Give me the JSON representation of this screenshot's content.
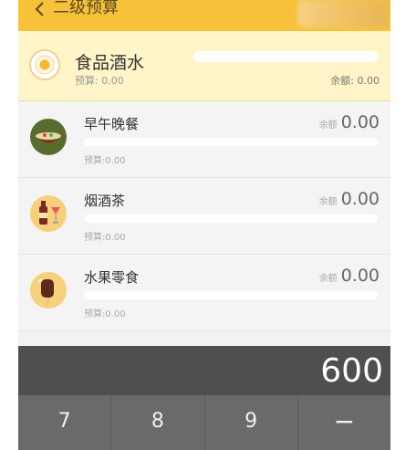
{
  "header": {
    "title": "二级预算",
    "back_icon": "chevron-left-icon"
  },
  "category": {
    "title": "食品酒水",
    "budget": "预算: 0.00",
    "remain": "余额: 0.00",
    "icon": "plate-egg-icon"
  },
  "rows": [
    {
      "name": "早午晚餐",
      "remain_label": "余额",
      "remain_value": "0.00",
      "budget": "预算:0.00",
      "icon": "bowl-icon"
    },
    {
      "name": "烟酒茶",
      "remain_label": "余额",
      "remain_value": "0.00",
      "budget": "预算:0.00",
      "icon": "bottle-glass-icon"
    },
    {
      "name": "水果零食",
      "remain_label": "余额",
      "remain_value": "0.00",
      "budget": "预算:0.00",
      "icon": "popsicle-icon"
    }
  ],
  "amount": "600",
  "keypad": {
    "keys": [
      "7",
      "8",
      "9",
      "−"
    ]
  },
  "colors": {
    "accent": "#f7c23a",
    "category_bg": "#fff5c9",
    "display_bg": "#4f4f4f",
    "keypad_bg": "#6a6a6a"
  }
}
